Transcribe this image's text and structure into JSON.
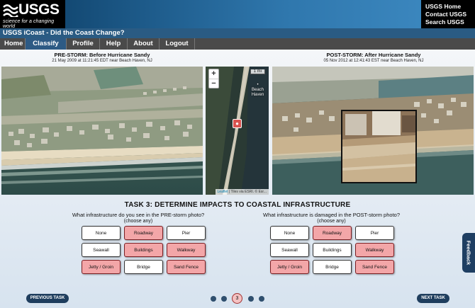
{
  "header": {
    "logo_text": "USGS",
    "logo_tagline": "science for a changing world",
    "links": [
      "USGS Home",
      "Contact USGS",
      "Search USGS"
    ]
  },
  "app_title": "USGS iCoast - Did the Coast Change?",
  "nav": [
    {
      "label": "Home",
      "active": false
    },
    {
      "label": "Classify",
      "active": true
    },
    {
      "label": "Profile",
      "active": false
    },
    {
      "label": "Help",
      "active": false
    },
    {
      "label": "About",
      "active": false
    },
    {
      "label": "Logout",
      "active": false
    }
  ],
  "pre_photo": {
    "title": "PRE-STORM: Before Hurricane Sandy",
    "subtitle": "21 May 2009 at 11:21:45 EDT near Beach Haven, NJ"
  },
  "post_photo": {
    "title": "POST-STORM: After Hurricane Sandy",
    "subtitle": "05 Nov 2012 at 12:41:43 EST near Beach Haven, NJ"
  },
  "map": {
    "zoom_in": "+",
    "zoom_out": "−",
    "scale": "1 mi",
    "place": "Beach Haven",
    "attribution_link": "Leaflet",
    "attribution_text": "| Tiles via ESRI. © Esr..."
  },
  "task_title": "TASK 3: DETERMINE IMPACTS TO COASTAL INFRASTRUCTURE",
  "left_question": {
    "text": "What infrastructure do you see in the PRE-storm photo?",
    "sub": "(choose any)",
    "options": [
      {
        "label": "None",
        "selected": false
      },
      {
        "label": "Roadway",
        "selected": true
      },
      {
        "label": "Pier",
        "selected": false
      },
      {
        "label": "Seawall",
        "selected": false
      },
      {
        "label": "Buildings",
        "selected": true
      },
      {
        "label": "Walkway",
        "selected": true
      },
      {
        "label": "Jetty / Groin",
        "selected": true
      },
      {
        "label": "Bridge",
        "selected": false
      },
      {
        "label": "Sand Fence",
        "selected": true
      }
    ]
  },
  "right_question": {
    "text": "What infrastructure is damaged in the POST-storm photo?",
    "sub": "(choose any)",
    "options": [
      {
        "label": "None",
        "selected": false
      },
      {
        "label": "Roadway",
        "selected": true
      },
      {
        "label": "Pier",
        "selected": false
      },
      {
        "label": "Seawall",
        "selected": false
      },
      {
        "label": "Buildings",
        "selected": false
      },
      {
        "label": "Walkway",
        "selected": true
      },
      {
        "label": "Jetty / Groin",
        "selected": true
      },
      {
        "label": "Bridge",
        "selected": false
      },
      {
        "label": "Sand Fence",
        "selected": true
      }
    ]
  },
  "footer": {
    "prev_label": "PREVIOUS TASK",
    "next_label": "NEXT TASK",
    "current_task": "3",
    "task_count": 5
  },
  "feedback_label": "Feedback",
  "colors": {
    "selected_fill": "#f3a6a8",
    "nav_active": "#2d5a84",
    "button_dark": "#1f3e5e"
  }
}
